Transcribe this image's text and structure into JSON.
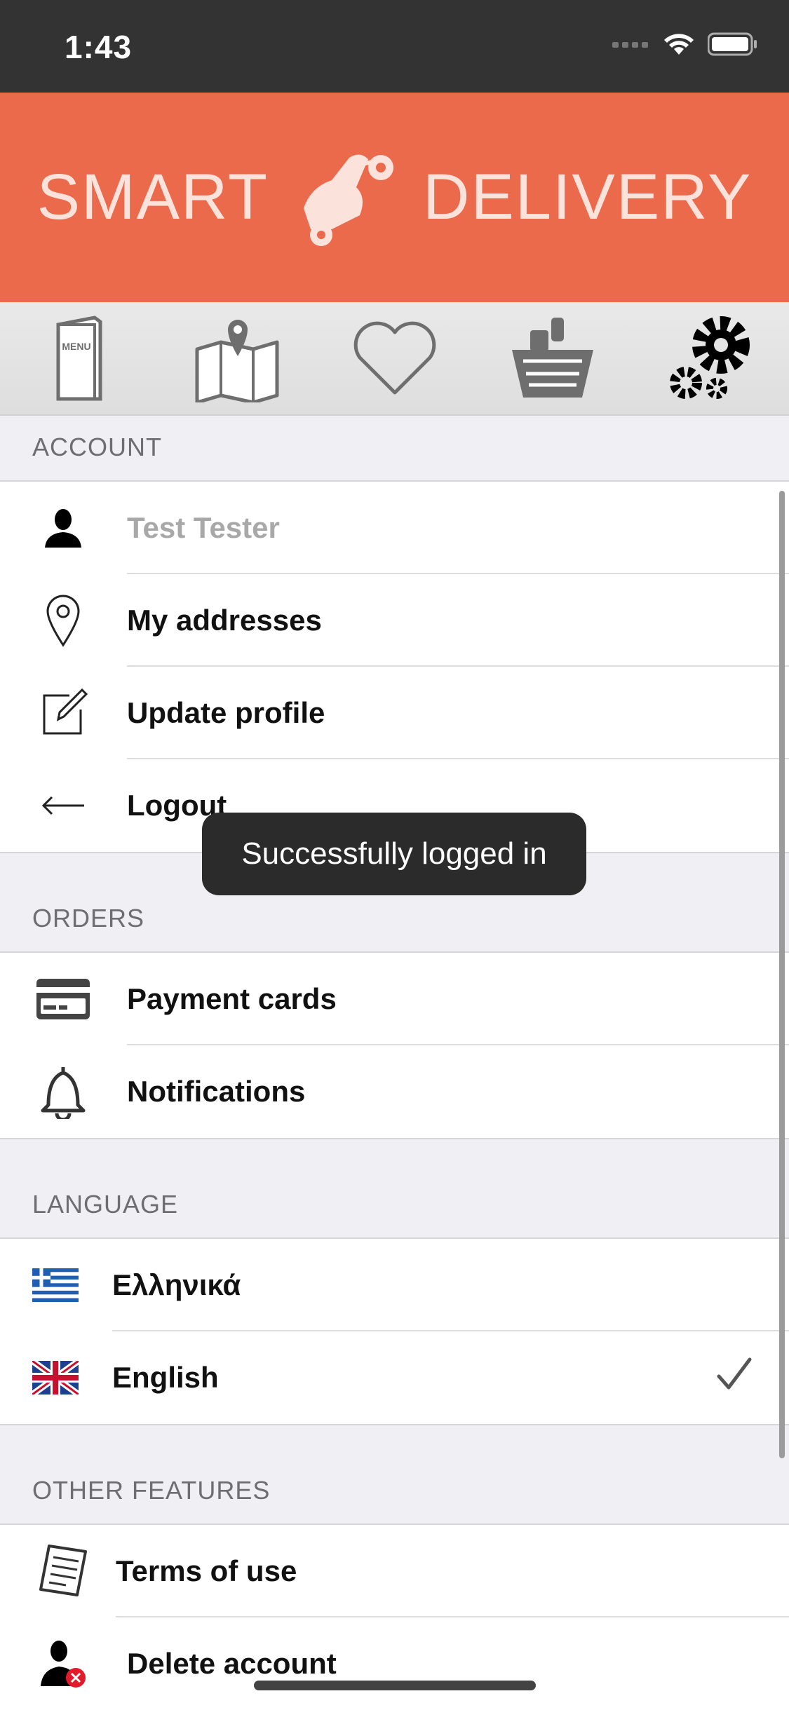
{
  "status": {
    "time": "1:43"
  },
  "banner": {
    "left": "SMART",
    "right": "DELIVERY"
  },
  "nav": {
    "items": [
      {
        "icon": "menu-booklet-icon",
        "text": "MENU"
      },
      {
        "icon": "map-pin-icon"
      },
      {
        "icon": "heart-icon"
      },
      {
        "icon": "basket-icon"
      },
      {
        "icon": "gears-icon"
      }
    ]
  },
  "account": {
    "header": "ACCOUNT",
    "items": [
      {
        "label": "Test Tester",
        "icon": "user-silhouette-icon"
      },
      {
        "label": "My addresses",
        "icon": "location-pin-icon"
      },
      {
        "label": "Update profile",
        "icon": "edit-icon"
      },
      {
        "label": "Logout",
        "icon": "arrow-left-icon"
      }
    ]
  },
  "toast": {
    "message": "Successfully logged in"
  },
  "orders": {
    "header": "ORDERS",
    "items": [
      {
        "label": "Payment cards",
        "icon": "credit-card-icon"
      },
      {
        "label": "Notifications",
        "icon": "bell-icon"
      }
    ]
  },
  "language": {
    "header": "LANGUAGE",
    "items": [
      {
        "label": "Ελληνικά",
        "icon": "greek-flag-icon",
        "selected": false
      },
      {
        "label": "English",
        "icon": "uk-flag-icon",
        "selected": true
      }
    ]
  },
  "other": {
    "header": "OTHER FEATURES",
    "items": [
      {
        "label": "Terms of use",
        "icon": "document-icon"
      },
      {
        "label": "Delete account",
        "icon": "user-remove-icon"
      }
    ]
  },
  "colors": {
    "brand": "#eb6a4c",
    "status_bar": "#333333",
    "background": "#efeff4"
  }
}
